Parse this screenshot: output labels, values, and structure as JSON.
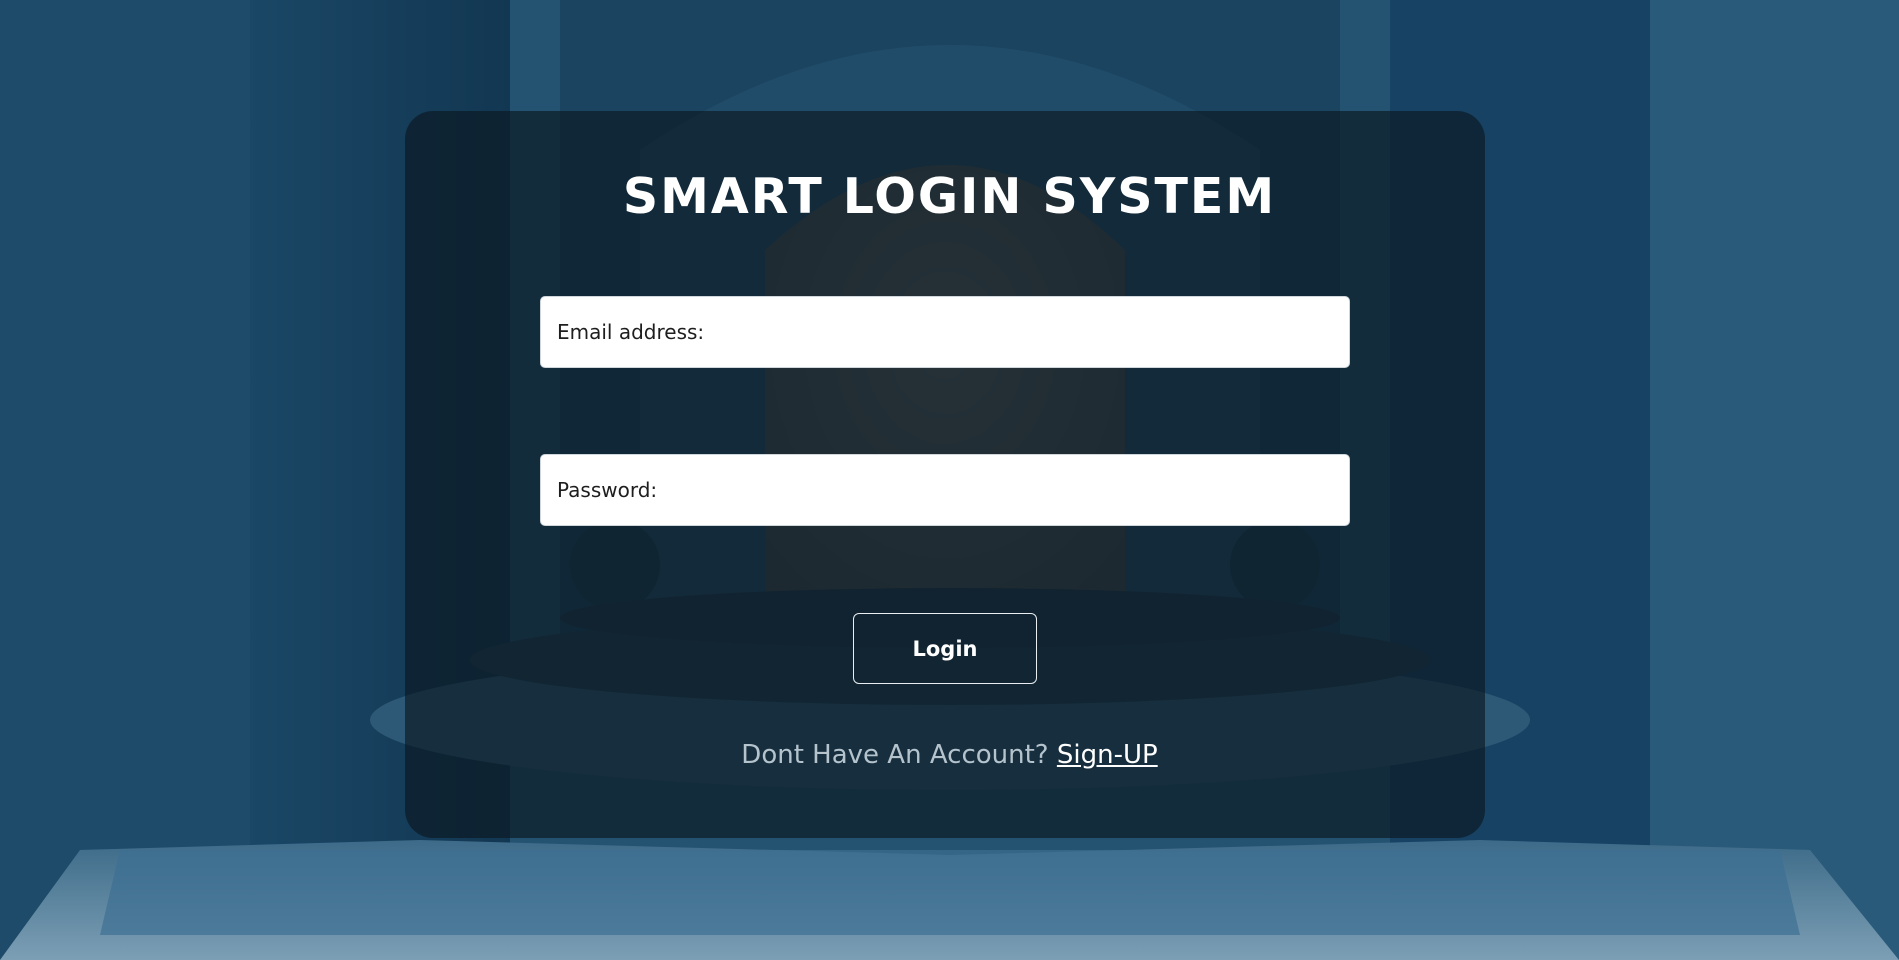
{
  "login": {
    "title": "SMART LOGIN SYSTEM",
    "email_placeholder": "Email address:",
    "password_placeholder": "Password:",
    "login_label": "Login",
    "signup_prompt": "Dont Have An Account? ",
    "signup_link": "Sign-UP"
  },
  "colors": {
    "background": "#1f4a66",
    "card": "#0a1821",
    "title": "#ffffff",
    "prompt_text": "#b4c3cc"
  }
}
